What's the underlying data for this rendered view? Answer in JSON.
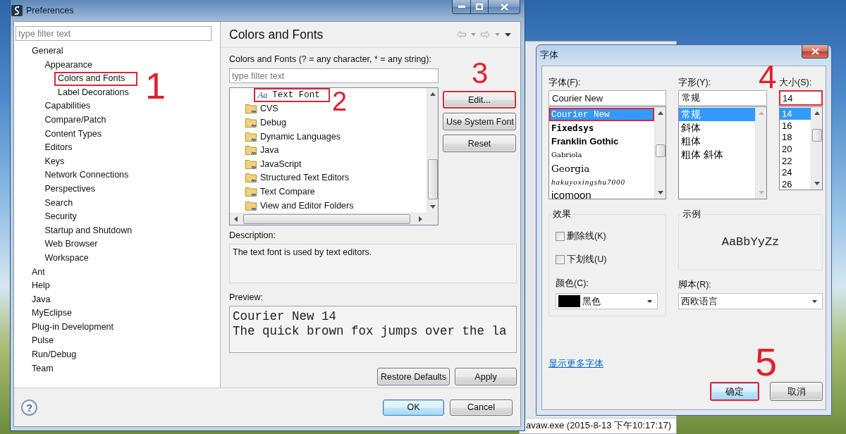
{
  "preferences": {
    "title": "Preferences",
    "filter": {
      "placeholder": "type filter text"
    },
    "tree": [
      {
        "label": "General",
        "highlighted": false,
        "children": [
          {
            "label": "Appearance",
            "highlighted": false,
            "children": [
              {
                "label": "Colors and Fonts",
                "highlighted": true
              },
              {
                "label": "Label Decorations",
                "highlighted": false
              }
            ]
          },
          {
            "label": "Capabilities",
            "highlighted": false
          },
          {
            "label": "Compare/Patch",
            "highlighted": false
          },
          {
            "label": "Content Types",
            "highlighted": false
          },
          {
            "label": "Editors",
            "highlighted": false
          },
          {
            "label": "Keys",
            "highlighted": false
          },
          {
            "label": "Network Connections",
            "highlighted": false
          },
          {
            "label": "Perspectives",
            "highlighted": false
          },
          {
            "label": "Search",
            "highlighted": false
          },
          {
            "label": "Security",
            "highlighted": false
          },
          {
            "label": "Startup and Shutdown",
            "highlighted": false
          },
          {
            "label": "Web Browser",
            "highlighted": false
          },
          {
            "label": "Workspace",
            "highlighted": false
          }
        ]
      },
      {
        "label": "Ant",
        "highlighted": false
      },
      {
        "label": "Help",
        "highlighted": false
      },
      {
        "label": "Java",
        "highlighted": false
      },
      {
        "label": "MyEclipse",
        "highlighted": false
      },
      {
        "label": "Plug-in Development",
        "highlighted": false
      },
      {
        "label": "Pulse",
        "highlighted": false
      },
      {
        "label": "Run/Debug",
        "highlighted": false
      },
      {
        "label": "Team",
        "highlighted": false
      }
    ],
    "page": {
      "title": "Colors and Fonts",
      "filter_label": "Colors and Fonts (? = any character, * = any string):",
      "filter": {
        "placeholder": "type filter text"
      },
      "items": [
        {
          "kind": "font",
          "glyph": "Aa",
          "label": "Text Font",
          "highlighted": true
        },
        {
          "kind": "category",
          "label": "CVS",
          "highlighted": false
        },
        {
          "kind": "category",
          "label": "Debug",
          "highlighted": false
        },
        {
          "kind": "category",
          "label": "Dynamic Languages",
          "highlighted": false
        },
        {
          "kind": "category",
          "label": "Java",
          "highlighted": false
        },
        {
          "kind": "category",
          "label": "JavaScript",
          "highlighted": false
        },
        {
          "kind": "category",
          "label": "Structured Text Editors",
          "highlighted": false
        },
        {
          "kind": "category",
          "label": "Text Compare",
          "highlighted": false
        },
        {
          "kind": "category",
          "label": "View and Editor Folders",
          "highlighted": false
        }
      ],
      "side_buttons": [
        {
          "label": "Edit...",
          "highlighted": true
        },
        {
          "label": "Use System Font",
          "highlighted": false
        },
        {
          "label": "Reset",
          "highlighted": false
        }
      ],
      "description_label": "Description:",
      "description": "The text font is used by text editors.",
      "preview_label": "Preview:",
      "preview_lines": [
        "Courier New 14",
        "The quick brown fox jumps over the la"
      ],
      "buttons": [
        "Restore Defaults",
        "Apply"
      ]
    },
    "help_button": "?",
    "buttons": [
      {
        "label": "OK",
        "default": true
      },
      {
        "label": "Cancel",
        "default": false
      }
    ]
  },
  "console_window": {
    "status": "avaw.exe (2015-8-13 下午10:17:17)"
  },
  "font_dialog": {
    "title": "字体",
    "font": {
      "label": "字体(F):",
      "value": "Courier New",
      "highlighted": false,
      "options": [
        {
          "label": "Courier New",
          "kind": "mono",
          "selected": true,
          "highlighted": true
        },
        {
          "label": "Fixedsys",
          "kind": "heavymono",
          "selected": false,
          "highlighted": false
        },
        {
          "label": "Franklin Gothic",
          "kind": "heavy",
          "selected": false,
          "highlighted": false
        },
        {
          "label": "Gabriola",
          "kind": "light",
          "selected": false,
          "highlighted": false
        },
        {
          "label": "Georgia",
          "kind": "serif",
          "selected": false,
          "highlighted": false
        },
        {
          "label": "hakuyoxingshu7000",
          "kind": "script",
          "selected": false,
          "highlighted": false
        },
        {
          "label": "icomoon",
          "kind": "plain",
          "selected": false,
          "highlighted": false
        }
      ]
    },
    "style": {
      "label": "字形(Y):",
      "value": "常规",
      "highlighted": false,
      "options": [
        {
          "label": "常规",
          "selected": true
        },
        {
          "label": "斜体",
          "selected": false
        },
        {
          "label": "粗体",
          "selected": false
        },
        {
          "label": "粗体 斜体",
          "selected": false
        }
      ]
    },
    "size": {
      "label": "大小(S):",
      "value": "14",
      "highlighted": true,
      "options": [
        {
          "label": "14",
          "selected": true
        },
        {
          "label": "16",
          "selected": false
        },
        {
          "label": "18",
          "selected": false
        },
        {
          "label": "20",
          "selected": false
        },
        {
          "label": "22",
          "selected": false
        },
        {
          "label": "24",
          "selected": false
        },
        {
          "label": "26",
          "selected": false
        }
      ]
    },
    "effects": {
      "title": "效果",
      "checkboxes": [
        {
          "label": "删除线(K)",
          "checked": false
        },
        {
          "label": "下划线(U)",
          "checked": false
        }
      ],
      "color_label": "颜色(C):",
      "color_field": {
        "value": "黑色",
        "color": "#000000"
      }
    },
    "sample": {
      "title": "示例",
      "text": "AaBbYyZz"
    },
    "script": {
      "label": "脚本(R):",
      "value": "西欧语言"
    },
    "link": "显示更多字体",
    "buttons": [
      {
        "label": "确定",
        "default": true,
        "highlighted": true
      },
      {
        "label": "取消",
        "default": false,
        "highlighted": false
      }
    ]
  },
  "annotations": [
    {
      "label": "1"
    },
    {
      "label": "2"
    },
    {
      "label": "3"
    },
    {
      "label": "4"
    },
    {
      "label": "5"
    }
  ]
}
